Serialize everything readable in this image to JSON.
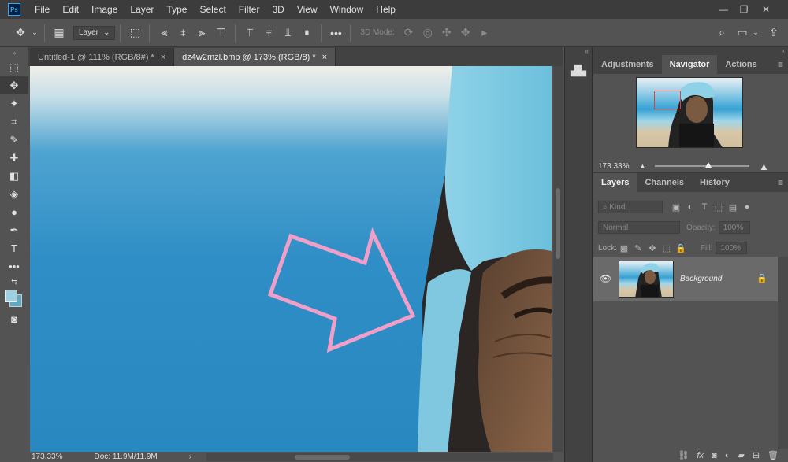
{
  "app": {
    "logo": "Ps"
  },
  "menu": [
    "File",
    "Edit",
    "Image",
    "Layer",
    "Type",
    "Select",
    "Filter",
    "3D",
    "View",
    "Window",
    "Help"
  ],
  "window_controls": {
    "minimize": "—",
    "restore": "❐",
    "close": "✕"
  },
  "options": {
    "layer_select": "Layer",
    "three_d_mode": "3D Mode:",
    "more": "•••"
  },
  "tabs": [
    {
      "label": "Untitled-1 @ 111% (RGB/8#) *",
      "close": "×"
    },
    {
      "label": "dz4w2mzl.bmp @ 173% (RGB/8) *",
      "close": "×"
    }
  ],
  "status": {
    "zoom": "173.33%",
    "doc": "Doc: 11.9M/11.9M",
    "arrow": "›"
  },
  "panels": {
    "top_tabs": [
      "Adjustments",
      "Navigator",
      "Actions"
    ],
    "navigator_zoom": "173.33%",
    "layer_tabs": [
      "Layers",
      "Channels",
      "History"
    ],
    "kind": "Kind",
    "blend": "Normal",
    "opacity_label": "Opacity:",
    "opacity": "100%",
    "lock_label": "Lock:",
    "fill_label": "Fill:",
    "fill": "100%",
    "layer_name": "Background",
    "bottom_icons": [
      "link",
      "fx",
      "mask",
      "adjust",
      "folder",
      "new",
      "trash"
    ]
  },
  "colors": {
    "arrow": "#f0a0c8",
    "selection": "#e0403c"
  }
}
